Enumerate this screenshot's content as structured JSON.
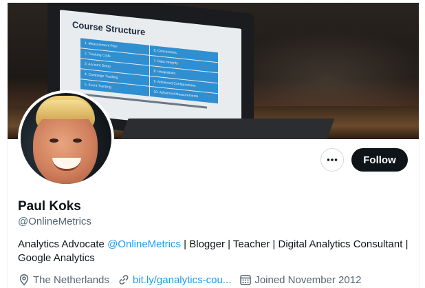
{
  "profile": {
    "name": "Paul Koks",
    "handle": "@OnlineMetrics",
    "bio": {
      "prefix": "Analytics Advocate ",
      "mention": "@OnlineMetrics",
      "suffix": " | Blogger | Teacher | Digital Analytics Consultant | Google Analytics"
    },
    "location": "The Netherlands",
    "website": "bit.ly/ganalytics-cou...",
    "joined": "Joined November 2012"
  },
  "actions": {
    "more_label": "More",
    "follow_label": "Follow"
  },
  "banner": {
    "slide_title": "Course Structure",
    "slide_items": [
      "1. Measurement Plan",
      "6. Conversions",
      "2. Tracking Code",
      "7. Data Integrity",
      "3. Account Setup",
      "8. Integrations",
      "4. Campaign Tracking",
      "9. Advanced Configurations",
      "5. Event Tracking",
      "10. Advanced Measurements"
    ]
  },
  "colors": {
    "link": "#1d9bf0",
    "text_primary": "#0f1419",
    "text_secondary": "#536471",
    "follow_bg": "#0f1419"
  },
  "icons": {
    "more": "more-icon",
    "location": "location-icon",
    "link": "link-icon",
    "calendar": "calendar-icon"
  }
}
